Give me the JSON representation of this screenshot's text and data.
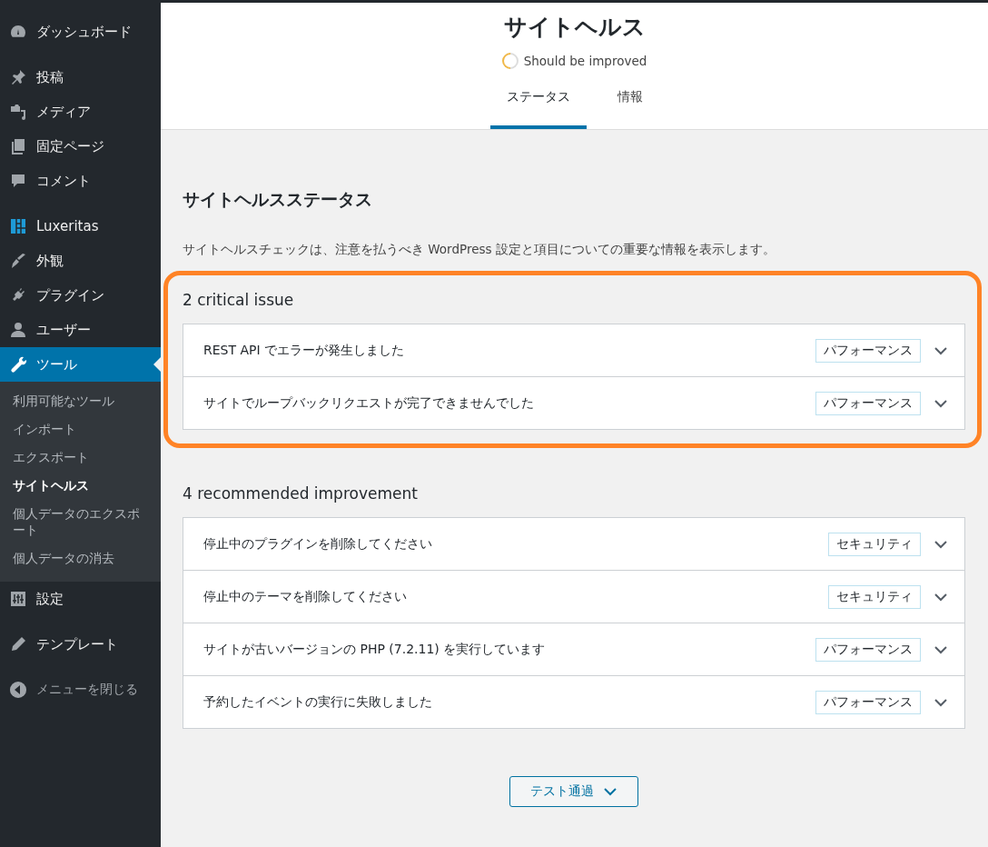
{
  "sidebar": {
    "groups": [
      [
        {
          "label": "ダッシュボード",
          "selected": false
        }
      ],
      [
        {
          "label": "投稿",
          "selected": false
        },
        {
          "label": "メディア",
          "selected": false
        },
        {
          "label": "固定ページ",
          "selected": false
        },
        {
          "label": "コメント",
          "selected": false
        }
      ],
      [
        {
          "label": "Luxeritas",
          "selected": false
        },
        {
          "label": "外観",
          "selected": false
        },
        {
          "label": "プラグイン",
          "selected": false
        },
        {
          "label": "ユーザー",
          "selected": false
        },
        {
          "label": "ツール",
          "selected": true,
          "submenu": [
            {
              "label": "利用可能なツール",
              "selected": false
            },
            {
              "label": "インポート",
              "selected": false
            },
            {
              "label": "エクスポート",
              "selected": false
            },
            {
              "label": "サイトヘルス",
              "selected": true
            },
            {
              "label": "個人データのエクスポート",
              "selected": false
            },
            {
              "label": "個人データの消去",
              "selected": false
            }
          ]
        },
        {
          "label": "設定",
          "selected": false
        }
      ],
      [
        {
          "label": "テンプレート",
          "selected": false
        }
      ]
    ],
    "collapse": "メニューを閉じる"
  },
  "header": {
    "title": "サイトヘルス",
    "status": "Should be improved",
    "tabs": [
      {
        "label": "ステータス",
        "selected": true
      },
      {
        "label": "情報",
        "selected": false
      }
    ]
  },
  "content": {
    "heading": "サイトヘルスステータス",
    "description": "サイトヘルスチェックは、注意を払うべき WordPress 設定と項目についての重要な情報を表示します。",
    "sections": [
      {
        "title": "2 critical issue",
        "highlighted": true,
        "issues": [
          {
            "label": "REST API でエラーが発生しました",
            "badge": "パフォーマンス"
          },
          {
            "label": "サイトでループバックリクエストが完了できませんでした",
            "badge": "パフォーマンス"
          }
        ]
      },
      {
        "title": "4 recommended improvement",
        "highlighted": false,
        "issues": [
          {
            "label": "停止中のプラグインを削除してください",
            "badge": "セキュリティ"
          },
          {
            "label": "停止中のテーマを削除してください",
            "badge": "セキュリティ"
          },
          {
            "label": "サイトが古いバージョンの PHP (7.2.11) を実行しています",
            "badge": "パフォーマンス"
          },
          {
            "label": "予約したイベントの実行に失敗しました",
            "badge": "パフォーマンス"
          }
        ]
      }
    ],
    "passed_button": "テスト通過"
  }
}
